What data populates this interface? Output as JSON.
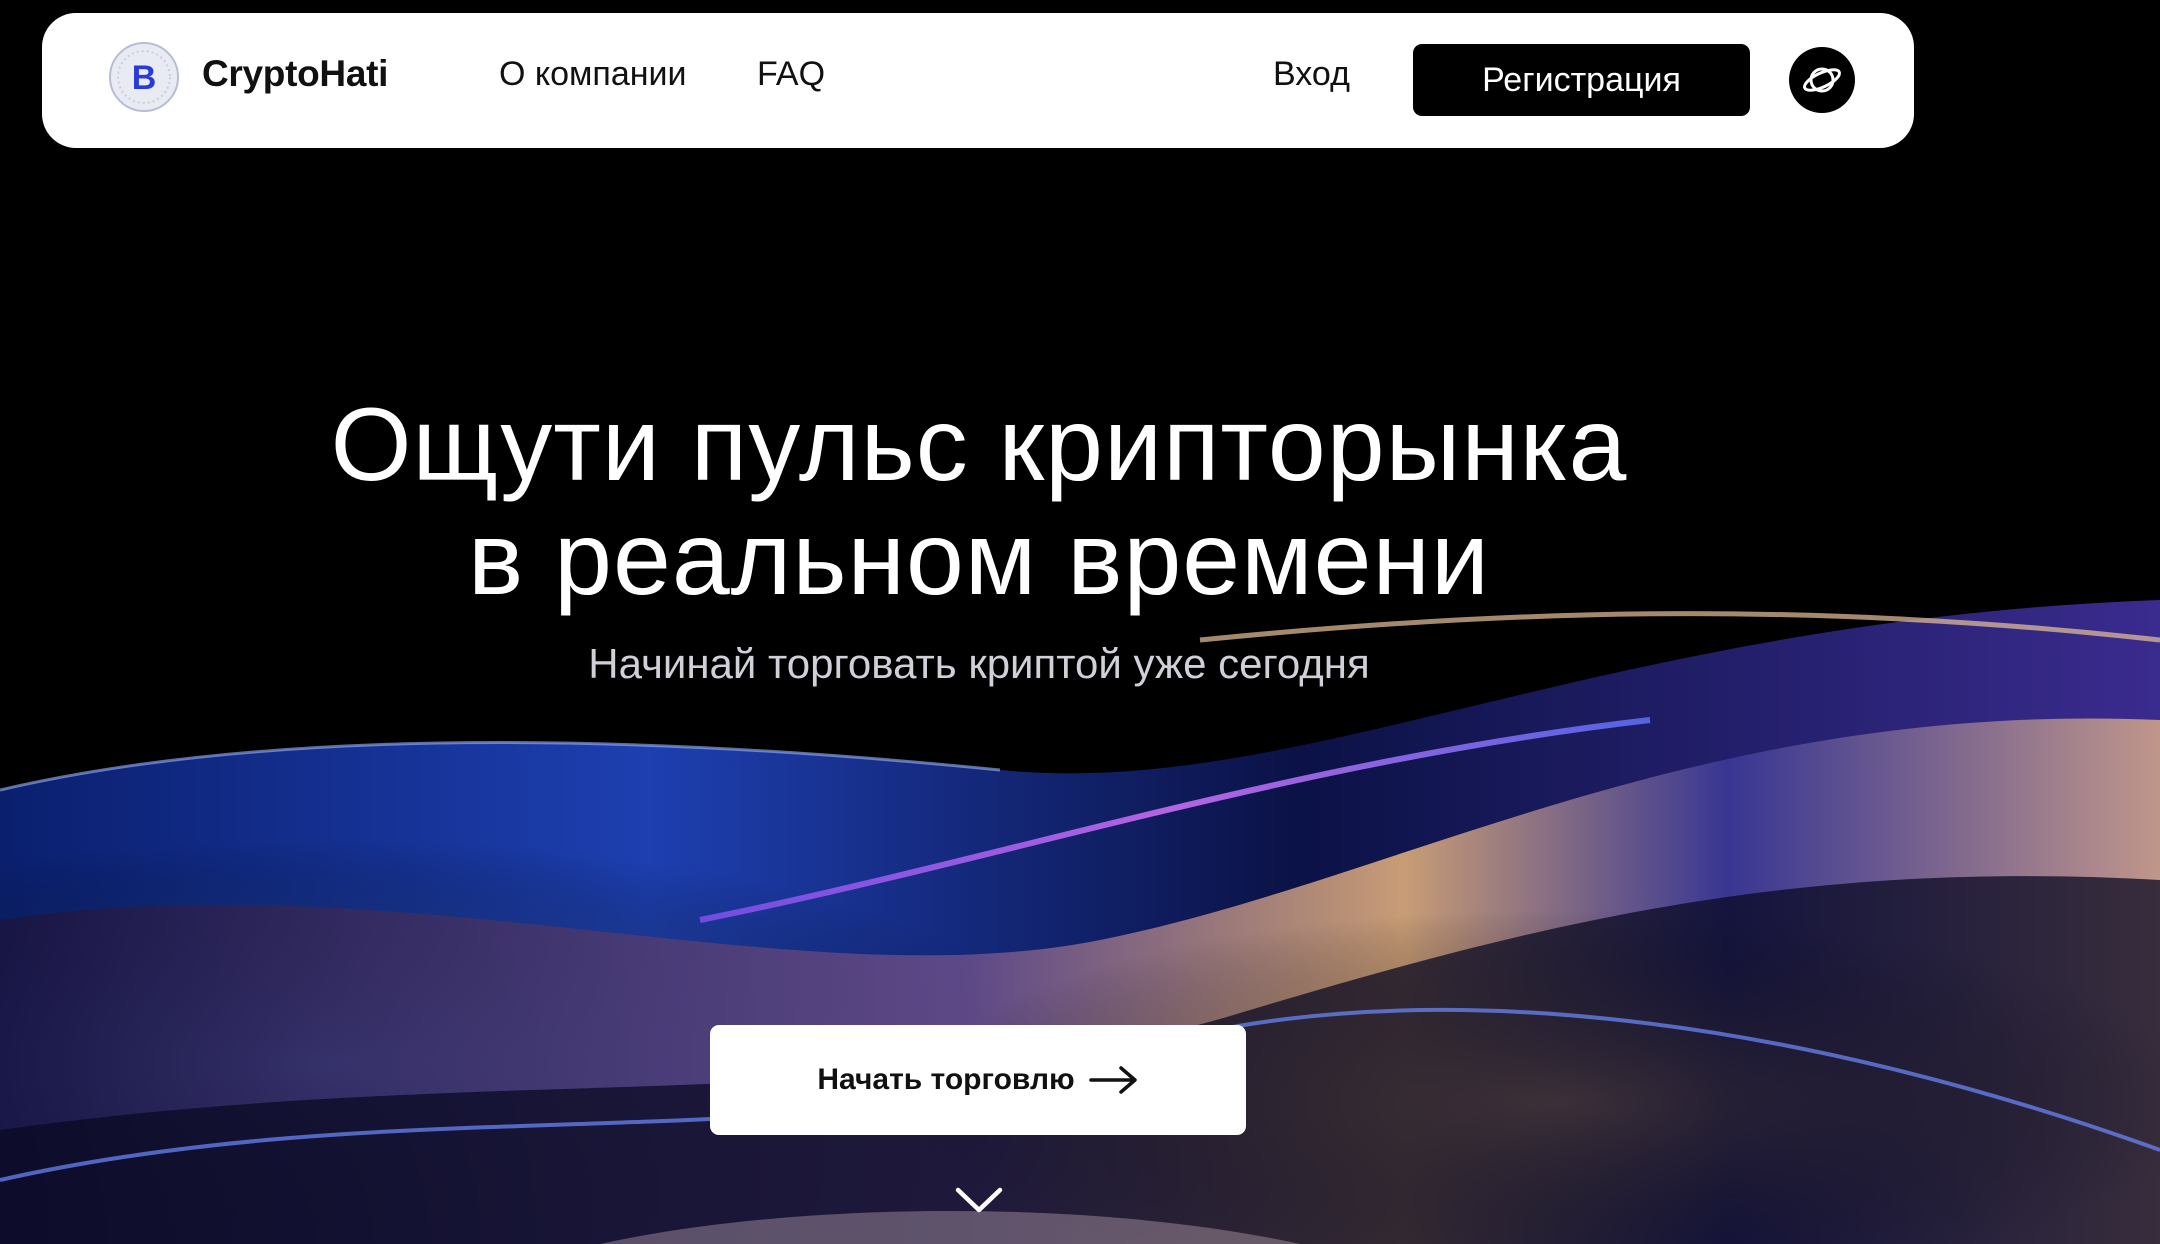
{
  "brand": {
    "name": "CryptoHati",
    "logo_icon": "bitcoin-coin-icon",
    "logo_letter": "B"
  },
  "nav": {
    "about": "О компании",
    "faq": "FAQ",
    "login": "Вход",
    "register": "Регистрация",
    "planet_icon": "planet-icon"
  },
  "hero": {
    "title_line1": "Ощути пульс крипторынка",
    "title_line2": "в реальном времени",
    "subtitle": "Начинай торговать криптой уже сегодня",
    "cta_label": "Начать торговлю",
    "cta_icon": "arrow-right-icon",
    "scroll_icon": "chevron-down-icon"
  },
  "colors": {
    "background": "#000000",
    "navbar": "#ffffff",
    "accent_blue": "#2a3bd9",
    "accent_purple": "#8a3fe0",
    "accent_gold": "#e0b27a"
  }
}
